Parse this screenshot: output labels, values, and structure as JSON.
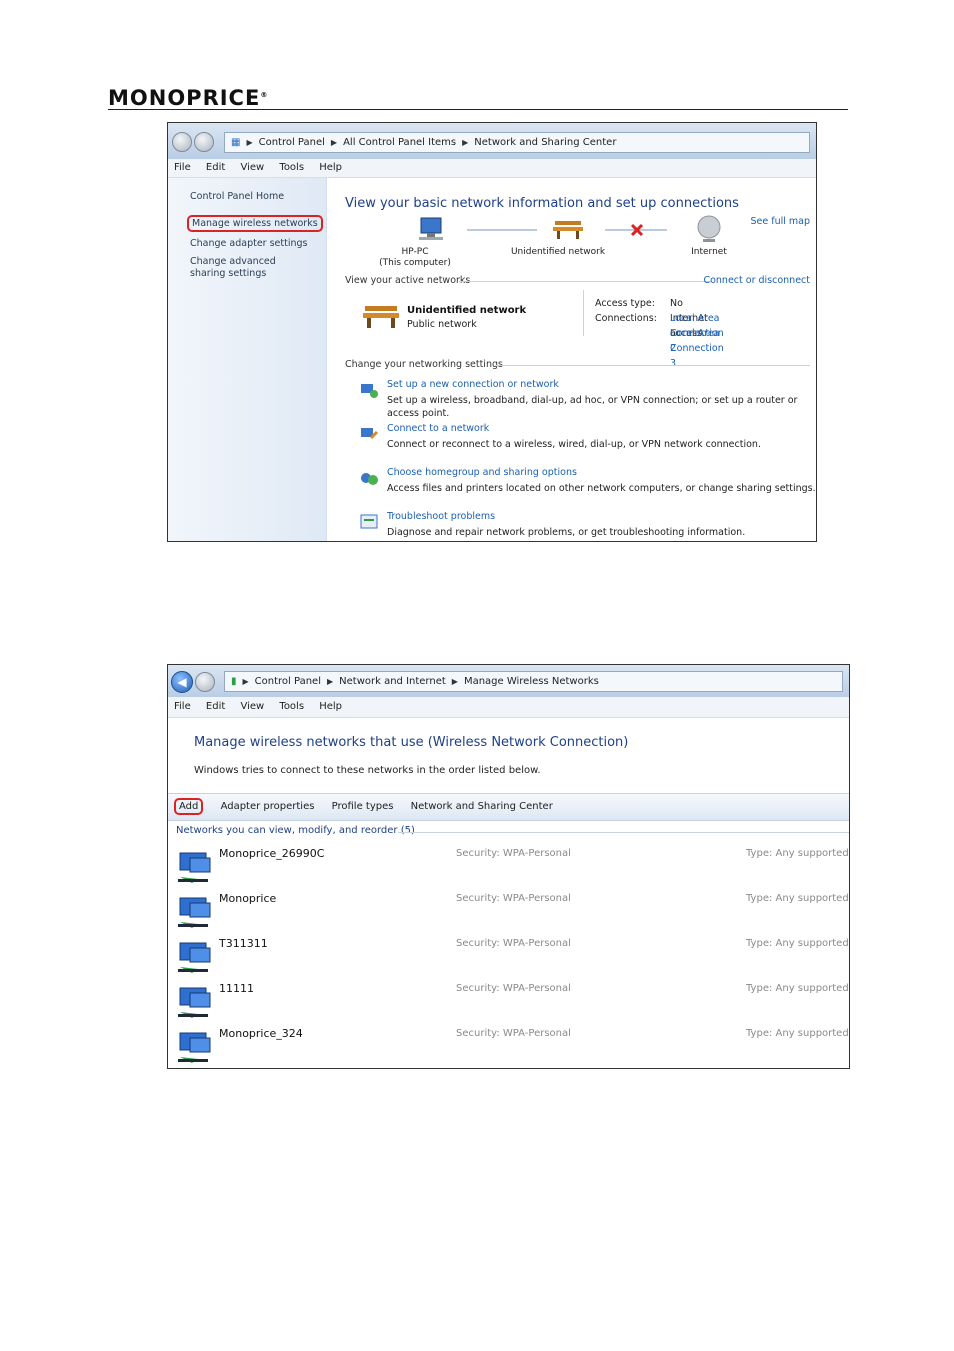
{
  "header": {
    "logo": "MONOPRICE",
    "logo_mark": "®"
  },
  "screen1": {
    "breadcrumb": [
      "Control Panel",
      "All Control Panel Items",
      "Network and Sharing Center"
    ],
    "menu": [
      "File",
      "Edit",
      "View",
      "Tools",
      "Help"
    ],
    "left_links": {
      "home": "Control Panel Home",
      "manage_wireless": "Manage wireless networks",
      "adapter": "Change adapter settings",
      "advanced": "Change advanced sharing settings"
    },
    "title": "View your basic network information and set up connections",
    "see_full_map": "See full map",
    "map": {
      "computer": "HP-PC",
      "computer_sub": "(This computer)",
      "network": "Unidentified network",
      "internet": "Internet"
    },
    "active_networks_label": "View your active networks",
    "connect_disconnect": "Connect or disconnect",
    "active": {
      "name": "Unidentified network",
      "type": "Public network",
      "access_label": "Access type:",
      "access_value": "No Internet access",
      "connections_label": "Connections:",
      "connections": [
        "Local Area Connection 2",
        "Local Area Connection 3"
      ]
    },
    "change_label": "Change your networking settings",
    "tasks": [
      {
        "title": "Set up a new connection or network",
        "desc": "Set up a wireless, broadband, dial-up, ad hoc, or VPN connection; or set up a router or access point."
      },
      {
        "title": "Connect to a network",
        "desc": "Connect or reconnect to a wireless, wired, dial-up, or VPN network connection."
      },
      {
        "title": "Choose homegroup and sharing options",
        "desc": "Access files and printers located on other network computers, or change sharing settings."
      },
      {
        "title": "Troubleshoot problems",
        "desc": "Diagnose and repair network problems, or get troubleshooting information."
      }
    ]
  },
  "screen2": {
    "breadcrumb": [
      "Control Panel",
      "Network and Internet",
      "Manage Wireless Networks"
    ],
    "menu": [
      "File",
      "Edit",
      "View",
      "Tools",
      "Help"
    ],
    "title": "Manage wireless networks that use (Wireless Network Connection)",
    "subtitle": "Windows tries to connect to these networks in the order listed below.",
    "toolbar": {
      "add": "Add",
      "adapter": "Adapter properties",
      "profile": "Profile types",
      "sharing": "Network and Sharing Center"
    },
    "group_header": "Networks you can view, modify, and reorder (5)",
    "networks": [
      {
        "name": "Monoprice_26990C",
        "security": "Security: WPA-Personal",
        "type": "Type: Any supported"
      },
      {
        "name": "Monoprice",
        "security": "Security: WPA-Personal",
        "type": "Type: Any supported"
      },
      {
        "name": "T311311",
        "security": "Security: WPA-Personal",
        "type": "Type: Any supported"
      },
      {
        "name": "11111",
        "security": "Security: WPA-Personal",
        "type": "Type: Any supported"
      },
      {
        "name": "Monoprice_324",
        "security": "Security: WPA-Personal",
        "type": "Type: Any supported"
      }
    ]
  }
}
